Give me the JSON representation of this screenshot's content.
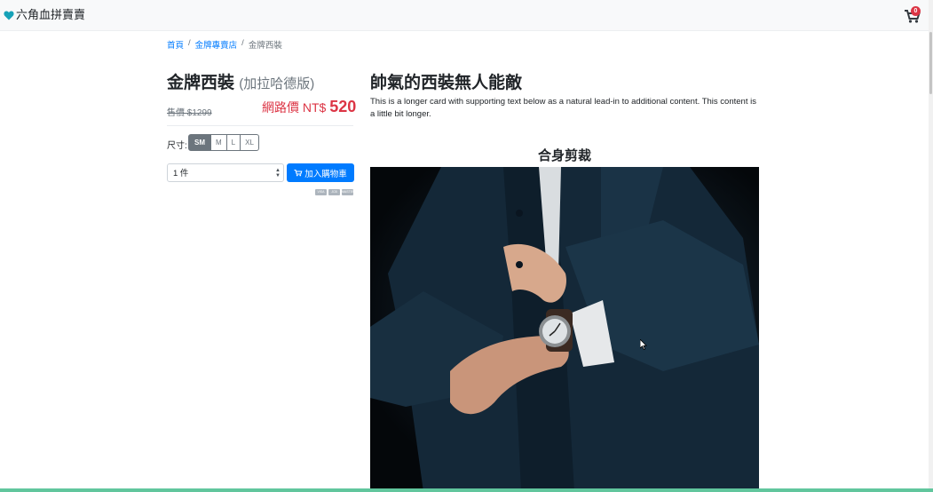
{
  "nav": {
    "brand": "六角血拼賣賣",
    "cart_count": "0"
  },
  "breadcrumb": {
    "home": "首頁",
    "store": "金牌專賣店",
    "current": "金牌西裝",
    "sep": "/"
  },
  "product": {
    "title": "金牌西裝",
    "subtitle": "(加拉哈德版)",
    "original_price": "售價 $1299",
    "web_price_label": "網路價 NT$",
    "web_price": "520",
    "size_label": "尺寸:",
    "sizes": [
      "SM",
      "M",
      "L",
      "XL"
    ],
    "selected_size": "SM",
    "quantity": "1 件",
    "add_to_cart": "加入購物車",
    "payment_icons": [
      "VISA",
      "JCB",
      "MASTER"
    ]
  },
  "card": {
    "title": "帥氣的西裝無人能敵",
    "text": "This is a longer card with supporting text below as a natural lead-in to additional content. This content is a little bit longer.",
    "section_title": "合身剪裁"
  },
  "colors": {
    "primary": "#007bff",
    "danger": "#dc3545",
    "secondary": "#6c757d",
    "accent_bar": "#61c69d"
  }
}
